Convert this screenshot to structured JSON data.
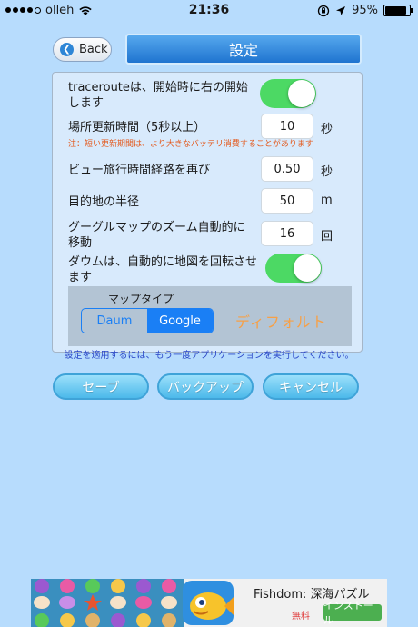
{
  "status_bar": {
    "carrier": "olleh",
    "time": "21:36",
    "battery": "95%",
    "battery_level": 0.95
  },
  "header": {
    "back_label": "Back",
    "title": "設定"
  },
  "settings": {
    "traceroute_label": "tracerouteは、開始時に右の開始します",
    "traceroute_on": true,
    "update_interval_label": "場所更新時間（5秒以上）",
    "update_interval_value": "10",
    "update_interval_unit": "秒",
    "update_interval_note": "注：短い更新期間は、より大きなバッテリ消費することがあります",
    "view_route_label": "ビュー旅行時間経路を再び",
    "view_route_value": "0.50",
    "view_route_unit": "秒",
    "radius_label": "目的地の半径",
    "radius_value": "50",
    "radius_unit": "m",
    "zoom_label": "グーグルマップのズーム自動的に移動",
    "zoom_value": "16",
    "zoom_unit": "回",
    "daum_rotate_label": "ダウムは、自動的に地図を回転させます",
    "daum_rotate_on": true,
    "map_type_label": "マップタイプ",
    "map_type_options": [
      "Daum",
      "Google"
    ],
    "map_type_selected": "Google",
    "default_label": "ディフォルト"
  },
  "apply_note": "設定を適用するには、もう一度アプリケーションを実行してください。",
  "actions": {
    "save_label": "セーブ",
    "backup_label": "バックアップ",
    "cancel_label": "キャンセル"
  },
  "ad": {
    "title": "Fishdom: 深海パズル",
    "price": "無料",
    "install_label": "インストール"
  },
  "colors": {
    "background": "#b7dcfd",
    "toggle_on": "#4cd964",
    "segment_accent": "#1a7ff5",
    "note_orange": "#e35a1e",
    "default_orange": "#f7a046"
  }
}
